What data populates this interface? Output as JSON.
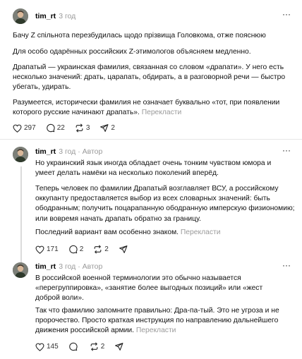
{
  "translate_label": "Перекласти",
  "author_label": "Автор",
  "posts": [
    {
      "user": "tim_rt",
      "time": "3 год",
      "paragraphs": [
        "Бачу Z спільнота перезбудилась щодо прізвища Головкома, отже пояснюю",
        "Для особо одарённых российских Z-этимологов объясняем медленно.",
        "Драпатый — украинская фамилия, связанная со словом «драпати». У него есть несколько значений: драть, царапать, обдирать, а в разговорной речи — быстро убегать, удирать.",
        "Разумеется, исторически фамилия не означает буквально «тот, при появлении которого русские начинают драпать»."
      ],
      "likes": "297",
      "replies": "22",
      "reposts": "3",
      "shares": "2"
    },
    {
      "user": "tim_rt",
      "time": "3 год",
      "paragraphs": [
        "Но украинский язык иногда обладает очень тонким чувством юмора и умеет делать намёки на несколько поколений вперёд.",
        "Теперь человек по фамилии Драпатый возглавляет ВСУ, а российскому оккупанту предоставляется выбор из всех словарных значений: быть ободранным; получить поцарапанную ободранную имперскую физиономию; или вовремя начать драпать обратно за границу.",
        "Последний вариант вам особенно знаком."
      ],
      "likes": "171",
      "replies": "2",
      "reposts": "2",
      "shares": ""
    },
    {
      "user": "tim_rt",
      "time": "3 год",
      "paragraphs": [
        "В российской военной терминологии это обычно называется «перегруппировка», «занятие более выгодных позиций» или «жест доброй воли».",
        "Так что фамилию запомните правильно: Дра-па-тый. Это не угроза и не пророчество. Просто краткая инструкция по направлению дальнейшего движения российской армии."
      ],
      "likes": "145",
      "replies": "",
      "reposts": "2",
      "shares": ""
    }
  ]
}
